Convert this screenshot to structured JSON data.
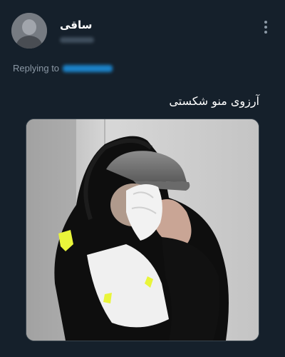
{
  "tweet": {
    "display_name": "ساقی",
    "replying_to_label": "Replying to",
    "text": "آرزوی منو شکستی",
    "more_icon": "more-vertical-icon",
    "media_alt": "meme image of a person in a black hoodie and grey cap wiping their face with a tissue"
  },
  "colors": {
    "background": "#15202b",
    "text_primary": "#ffffff",
    "text_secondary": "#8b98a5",
    "accent": "#1d9bf0",
    "border": "#38444d"
  }
}
